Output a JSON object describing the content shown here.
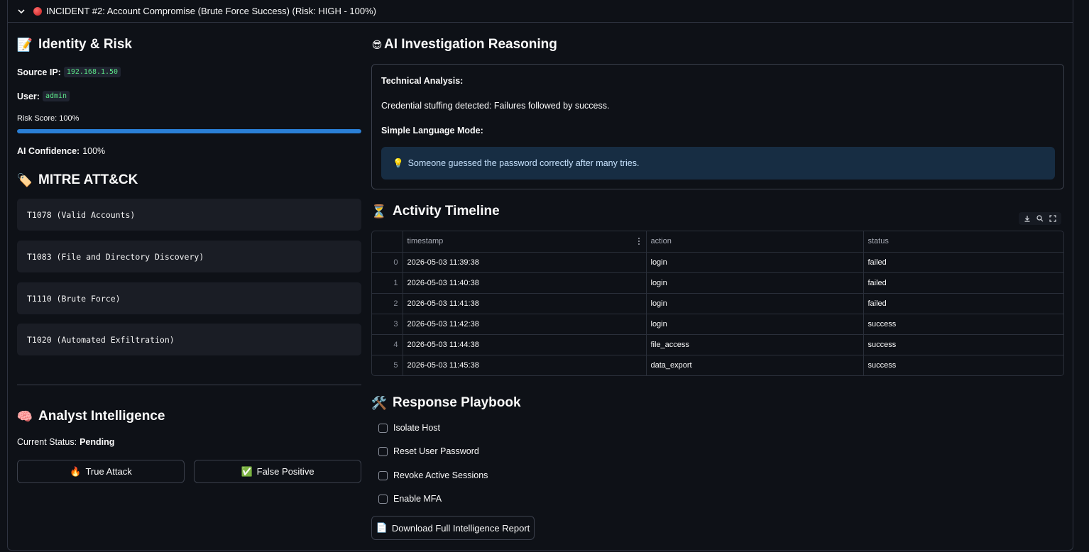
{
  "incident": {
    "title": "INCIDENT #2: Account Compromise (Brute Force Success) (Risk: HIGH - 100%)",
    "status_dot_color": "#e03131"
  },
  "identity": {
    "heading": "Identity & Risk",
    "heading_icon": "📝",
    "source_ip_label": "Source IP:",
    "source_ip": "192.168.1.50",
    "user_label": "User:",
    "user": "admin",
    "risk_label": "Risk Score: 100%",
    "risk_value": 100,
    "confidence_label": "AI Confidence:",
    "confidence_value": "100%"
  },
  "mitre": {
    "heading": "MITRE ATT&CK",
    "heading_icon": "🏷️",
    "items": [
      "T1078 (Valid Accounts)",
      "T1083 (File and Directory Discovery)",
      "T1110 (Brute Force)",
      "T1020 (Automated Exfiltration)"
    ]
  },
  "analyst": {
    "heading": "Analyst Intelligence",
    "heading_icon": "🧠",
    "status_label": "Current Status:",
    "status_value": "Pending",
    "true_attack_label": "True Attack",
    "true_attack_icon": "🔥",
    "false_positive_label": "False Positive",
    "false_positive_icon": "✅"
  },
  "reasoning": {
    "heading": "AI Investigation Reasoning",
    "heading_icon": "😎",
    "technical_label": "Technical Analysis:",
    "technical_text": "Credential stuffing detected: Failures followed by success.",
    "simple_label": "Simple Language Mode:",
    "simple_text": "Someone guessed the password correctly after many tries.",
    "simple_icon": "💡"
  },
  "timeline": {
    "heading": "Activity Timeline",
    "heading_icon": "⏳",
    "columns": [
      "timestamp",
      "action",
      "status"
    ],
    "rows": [
      {
        "idx": "0",
        "timestamp": "2026-05-03 11:39:38",
        "action": "login",
        "status": "failed"
      },
      {
        "idx": "1",
        "timestamp": "2026-05-03 11:40:38",
        "action": "login",
        "status": "failed"
      },
      {
        "idx": "2",
        "timestamp": "2026-05-03 11:41:38",
        "action": "login",
        "status": "failed"
      },
      {
        "idx": "3",
        "timestamp": "2026-05-03 11:42:38",
        "action": "login",
        "status": "success"
      },
      {
        "idx": "4",
        "timestamp": "2026-05-03 11:44:38",
        "action": "file_access",
        "status": "success"
      },
      {
        "idx": "5",
        "timestamp": "2026-05-03 11:45:38",
        "action": "data_export",
        "status": "success"
      }
    ]
  },
  "playbook": {
    "heading": "Response Playbook",
    "heading_icon": "🛠️",
    "items": [
      "Isolate Host",
      "Reset User Password",
      "Revoke Active Sessions",
      "Enable MFA"
    ],
    "download_label": "Download Full Intelligence Report",
    "download_icon": "📄"
  }
}
